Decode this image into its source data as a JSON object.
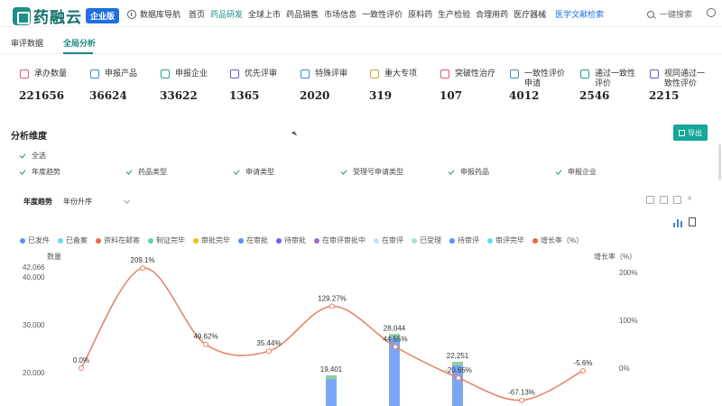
{
  "header": {
    "brand": "药融云",
    "badge": "企业版",
    "db_nav": "数据库导航",
    "nav": [
      "首页",
      "药品研发",
      "全球上市",
      "药品销售",
      "市场信息",
      "一致性评价",
      "原料药",
      "生产检验",
      "合理用药",
      "医疗器械"
    ],
    "nav_active": "药品研发",
    "literature": "医学文献检索",
    "search_placeholder": "一键搜索"
  },
  "tabs": [
    "审评数据",
    "全局分析"
  ],
  "active_tab": "全局分析",
  "stats": [
    {
      "label": "承办数量",
      "value": "221656",
      "color": "#e05a6f",
      "icon": "layers-icon"
    },
    {
      "label": "申报产品",
      "value": "36624",
      "color": "#3a8ad6",
      "icon": "cube-icon"
    },
    {
      "label": "申报企业",
      "value": "33622",
      "color": "#2aa08a",
      "icon": "building-icon"
    },
    {
      "label": "优先评审",
      "value": "1365",
      "color": "#6a5ad6",
      "icon": "car-icon"
    },
    {
      "label": "特殊评审",
      "value": "2020",
      "color": "#3a8ad6",
      "icon": "star-icon"
    },
    {
      "label": "重大专项",
      "value": "319",
      "color": "#d6a13a",
      "icon": "flag-icon"
    },
    {
      "label": "突破性治疗",
      "value": "107",
      "color": "#e05a6f",
      "icon": "medical-icon"
    },
    {
      "label": "一致性评价申请",
      "value": "4012",
      "color": "#3a8ad6",
      "icon": "document-icon"
    },
    {
      "label": "通过一致性评价",
      "value": "2546",
      "color": "#2aa08a",
      "icon": "check-circle-icon"
    },
    {
      "label": "视同通过一致性评价",
      "value": "2215",
      "color": "#6a5ad6",
      "icon": "check-circle-icon"
    }
  ],
  "analysis": {
    "title": "分析维度",
    "export": "导出",
    "select_all": "全选",
    "dimensions": [
      "年度趋势",
      "药品类型",
      "申请类型",
      "受理号申请类型",
      "申报药品",
      "申报企业"
    ]
  },
  "trend": {
    "title": "年度趋势",
    "sort": "年份升序"
  },
  "legend": [
    {
      "name": "已发件",
      "color": "#5b8ff9"
    },
    {
      "name": "已备案",
      "color": "#61ddf0"
    },
    {
      "name": "资料在邮寄",
      "color": "#e8684a"
    },
    {
      "name": "制证完毕",
      "color": "#5ad8a6"
    },
    {
      "name": "审批完毕",
      "color": "#f6bd16"
    },
    {
      "name": "在审批",
      "color": "#5b8ff9"
    },
    {
      "name": "待审批",
      "color": "#6f5ef9"
    },
    {
      "name": "在审评审批中",
      "color": "#9270ca"
    },
    {
      "name": "在审评",
      "color": "#c2e4f7"
    },
    {
      "name": "已受理",
      "color": "#a5e6c4"
    },
    {
      "name": "待审评",
      "color": "#5b8ff9"
    },
    {
      "name": "审评完毕",
      "color": "#61ddf0"
    },
    {
      "name": "增长率（%）",
      "color": "#e8684a"
    }
  ],
  "chart_data": {
    "type": "bar",
    "ylabel": "数量",
    "y2label": "增长率（%）",
    "yticks": [
      "20,000",
      "30,000",
      "40,000",
      "42,066"
    ],
    "y2ticks": [
      "200%",
      "100%",
      "0%"
    ],
    "bars": [
      {
        "value": 19401,
        "label": "19,401"
      },
      {
        "value": 28044,
        "label": "28,044"
      },
      {
        "value": 22251,
        "label": "22,251"
      }
    ],
    "growth": [
      {
        "value": 0.0,
        "label": "0.0%"
      },
      {
        "value": 209.1,
        "label": "209.1%"
      },
      {
        "value": 49.62,
        "label": "49.62%"
      },
      {
        "value": 35.44,
        "label": "35.44%"
      },
      {
        "value": 129.27,
        "label": "129.27%"
      },
      {
        "value": 44.55,
        "label": "44.55%"
      },
      {
        "value": -20.66,
        "label": "-20.66%"
      },
      {
        "value": -67.13,
        "label": "-67.13%"
      },
      {
        "value": -5.6,
        "label": "-5.6%"
      }
    ]
  }
}
